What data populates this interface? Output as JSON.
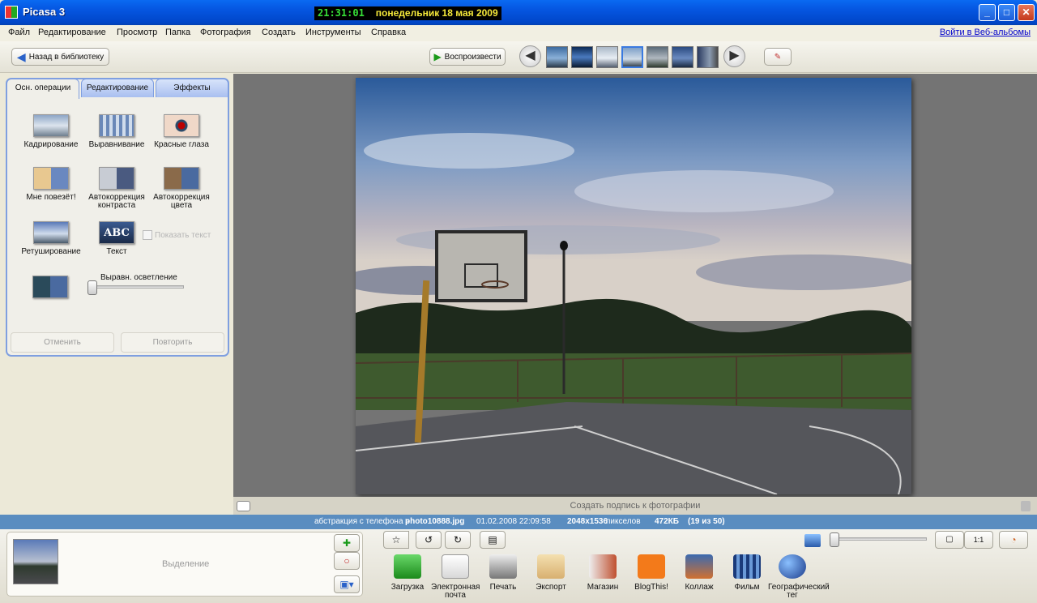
{
  "window": {
    "title": "Picasa 3",
    "clock_time": "21:31:01",
    "clock_date": "понедельник 18 мая 2009"
  },
  "menu": {
    "items": [
      "Файл",
      "Редактирование",
      "Просмотр",
      "Папка",
      "Фотография",
      "Создать",
      "Инструменты",
      "Справка"
    ],
    "web_albums_link": "Войти в Веб-альбомы"
  },
  "toolbar": {
    "back_label": "Назад в библиотеку",
    "play_label": "Воспроизвести"
  },
  "tabs": {
    "basic": "Осн. операции",
    "tuning": "Редактирование",
    "effects": "Эффекты"
  },
  "tools": {
    "crop": "Кадрирование",
    "straighten": "Выравнивание",
    "redeye": "Красные глаза",
    "lucky": "Мне повезёт!",
    "autocontrast": "Автокоррекция контраста",
    "autocolor": "Автокоррекция цвета",
    "retouch": "Ретуширование",
    "text": "Текст",
    "show_text": "Показать текст",
    "fill_light": "Выравн. осветление",
    "text_icon": "ABC"
  },
  "fill_light_level": 0,
  "undo_label": "Отменить",
  "redo_label": "Повторить",
  "caption_placeholder": "Создать подпись к фотографии",
  "status": {
    "path": "абстракция с телефона >",
    "file": "photo10888.jpg",
    "date": "01.02.2008 22:09:58",
    "dims": "2048x1536",
    "dims_unit": "пикселов",
    "size": "472КБ",
    "position": "(19 из 50)"
  },
  "selection_label": "Выделение",
  "actions": {
    "upload": "Загрузка",
    "email": "Электронная почта",
    "print": "Печать",
    "export": "Экспорт",
    "shop": "Магазин",
    "blog": "BlogThis!",
    "collage": "Коллаж",
    "movie": "Фильм",
    "geotag": "Географический тег"
  },
  "zoom": {
    "fit_label": "1:1"
  }
}
